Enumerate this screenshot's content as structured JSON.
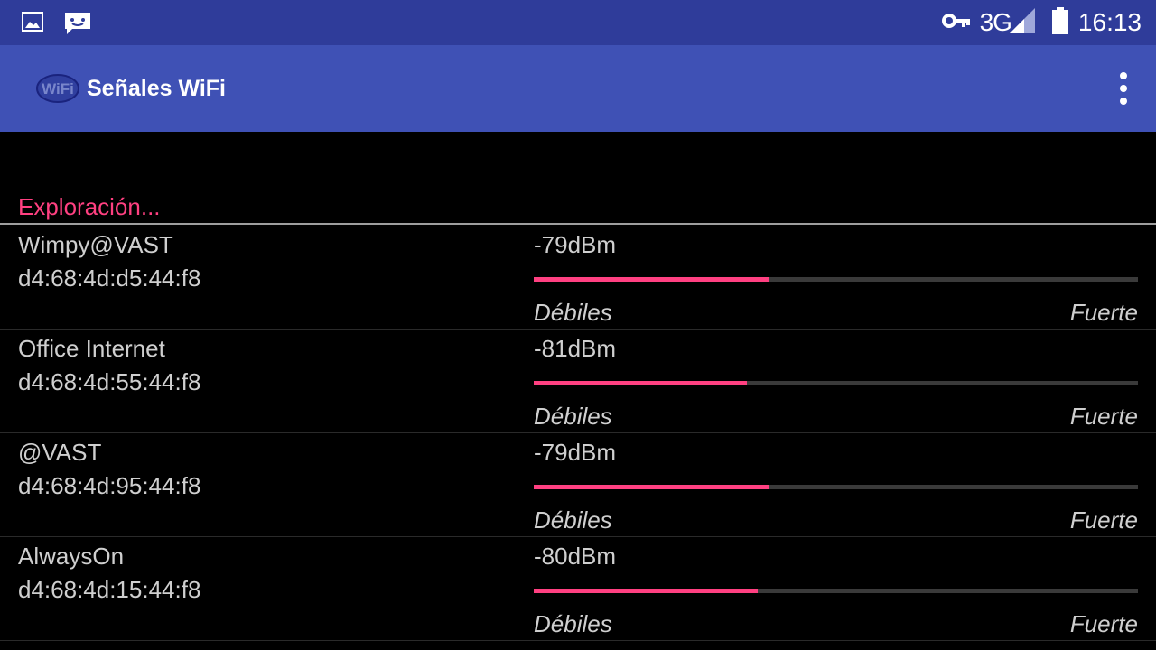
{
  "status_bar": {
    "icons_left": [
      "image-icon",
      "chat-icon"
    ],
    "network": "3G",
    "time": "16:13",
    "icons_right": [
      "vpn-key-icon",
      "signal-icon",
      "battery-icon"
    ]
  },
  "app_bar": {
    "title": "Señales WiFi",
    "logo_icon": "wifi-logo-icon",
    "logo_text": "WiFi",
    "menu_icon": "more-vert-icon"
  },
  "section": {
    "header": "Exploración..."
  },
  "colors": {
    "status_bar": "#2f3c9a",
    "app_bar": "#3f51b5",
    "accent": "#ff4081",
    "background": "#000000"
  },
  "networks": [
    {
      "ssid": "Wimpy@VAST",
      "bssid": "d4:68:4d:d5:44:f8",
      "dbm": "-79dBm",
      "signal_fraction": 0.39,
      "weak_label": "Débiles",
      "strong_label": "Fuerte"
    },
    {
      "ssid": "Office Internet",
      "bssid": "d4:68:4d:55:44:f8",
      "dbm": "-81dBm",
      "signal_fraction": 0.353,
      "weak_label": "Débiles",
      "strong_label": "Fuerte"
    },
    {
      "ssid": "@VAST",
      "bssid": "d4:68:4d:95:44:f8",
      "dbm": "-79dBm",
      "signal_fraction": 0.39,
      "weak_label": "Débiles",
      "strong_label": "Fuerte"
    },
    {
      "ssid": "AlwaysOn",
      "bssid": "d4:68:4d:15:44:f8",
      "dbm": "-80dBm",
      "signal_fraction": 0.371,
      "weak_label": "Débiles",
      "strong_label": "Fuerte"
    }
  ]
}
